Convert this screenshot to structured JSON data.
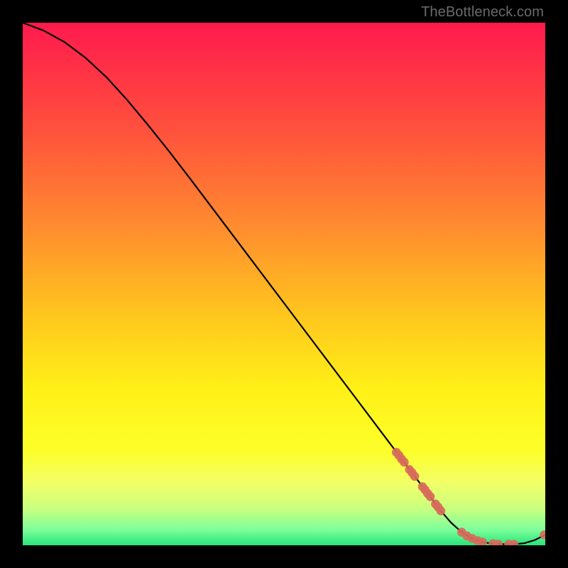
{
  "watermark": "TheBottleneck.com",
  "chart_data": {
    "type": "line",
    "title": "",
    "xlabel": "",
    "ylabel": "",
    "xlim": [
      0,
      100
    ],
    "ylim": [
      0,
      100
    ],
    "grid": false,
    "series": [
      {
        "name": "curve",
        "x": [
          0,
          4,
          8,
          12,
          16,
          20,
          24,
          28,
          32,
          36,
          40,
          44,
          48,
          52,
          56,
          60,
          64,
          68,
          72,
          76,
          80,
          82,
          84,
          86,
          88,
          90,
          92,
          94,
          96,
          98,
          100
        ],
        "y": [
          100,
          98.5,
          96.3,
          93.3,
          89.6,
          85.2,
          80.4,
          75.4,
          70.2,
          64.9,
          59.6,
          54.3,
          49.0,
          43.7,
          38.4,
          33.1,
          27.8,
          22.5,
          17.2,
          11.9,
          6.6,
          4.3,
          2.5,
          1.3,
          0.6,
          0.3,
          0.2,
          0.2,
          0.4,
          1.0,
          2.0
        ]
      }
    ],
    "markers": {
      "x": [
        71.5,
        72.0,
        72.5,
        73.0,
        74.0,
        74.5,
        75.0,
        76.5,
        77.0,
        77.5,
        78.0,
        79.0,
        79.5,
        80.0,
        84.0,
        85.0,
        86.0,
        87.0,
        88.0,
        90.0,
        91.0,
        93.0,
        94.0,
        99.8
      ],
      "y": [
        17.8,
        17.2,
        16.5,
        15.9,
        14.5,
        13.9,
        13.2,
        11.2,
        10.6,
        9.9,
        9.3,
        7.9,
        7.3,
        6.6,
        2.5,
        1.8,
        1.3,
        0.9,
        0.6,
        0.3,
        0.2,
        0.2,
        0.2,
        2.0
      ]
    },
    "background_gradient": {
      "stops": [
        {
          "offset": 0.0,
          "color": "#ff1a4d"
        },
        {
          "offset": 0.2,
          "color": "#ff4f3d"
        },
        {
          "offset": 0.4,
          "color": "#ff8f2e"
        },
        {
          "offset": 0.55,
          "color": "#ffc31f"
        },
        {
          "offset": 0.7,
          "color": "#fff017"
        },
        {
          "offset": 0.82,
          "color": "#fdff2a"
        },
        {
          "offset": 0.88,
          "color": "#f2ff66"
        },
        {
          "offset": 0.93,
          "color": "#c9ff80"
        },
        {
          "offset": 0.97,
          "color": "#7eff9b"
        },
        {
          "offset": 1.0,
          "color": "#28e47a"
        }
      ]
    }
  }
}
